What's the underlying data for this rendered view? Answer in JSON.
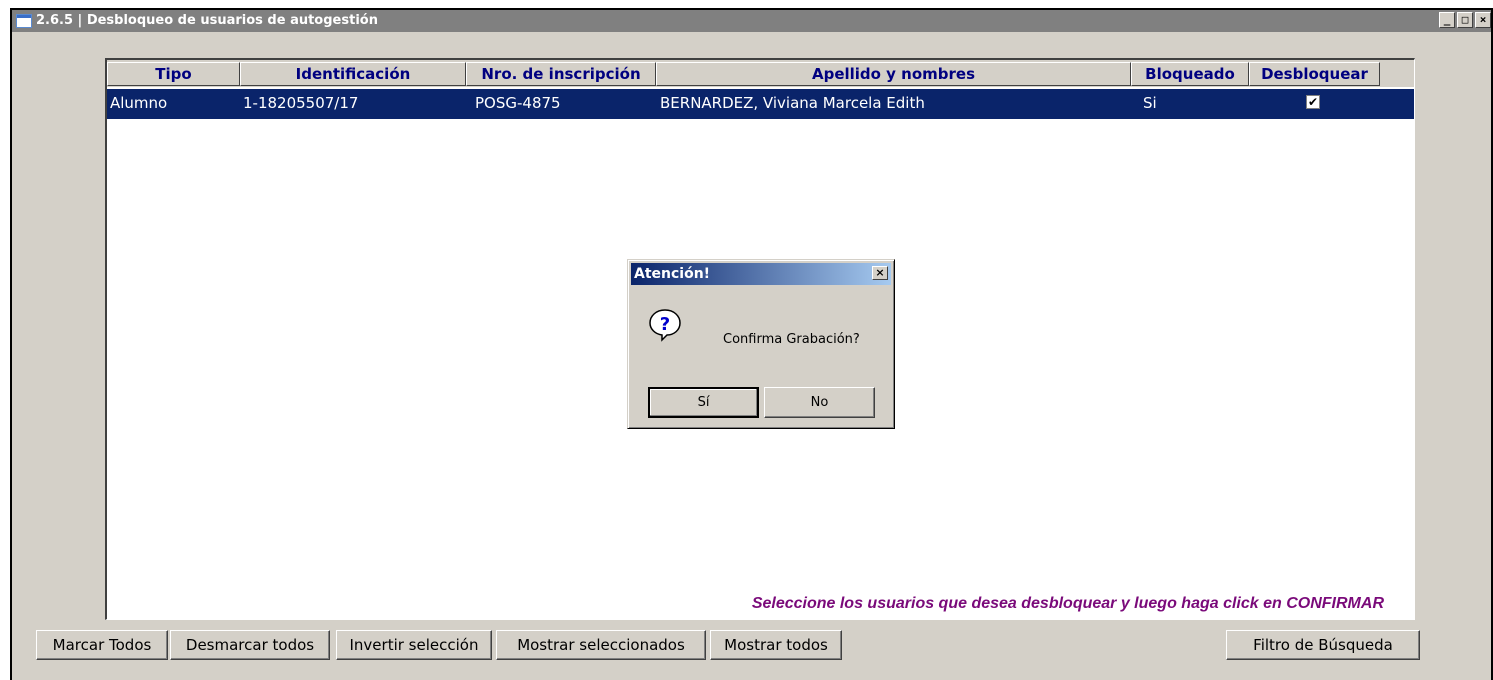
{
  "window": {
    "title": "2.6.5 | Desbloqueo de usuarios de autogestión",
    "controls": {
      "minimize": "_",
      "maximize": "□",
      "close": "×"
    }
  },
  "grid": {
    "columns": [
      "Tipo",
      "Identificación",
      "Nro. de inscripción",
      "Apellido y nombres",
      "Bloqueado",
      "Desbloquear"
    ],
    "rows": [
      {
        "tipo": "Alumno",
        "identificacion": "1-18205507/17",
        "nro_inscripcion": "POSG-4875",
        "apellido_nombres": "BERNARDEZ, Viviana Marcela Edith",
        "bloqueado": "Si",
        "desbloquear": "✔"
      }
    ],
    "hint": "Seleccione los usuarios que desea desbloquear y luego haga click en CONFIRMAR"
  },
  "buttons": {
    "marcar_todos": "Marcar Todos",
    "desmarcar_todos": "Desmarcar todos",
    "invertir": "Invertir selección",
    "mostrar_seleccionados": "Mostrar seleccionados",
    "mostrar_todos": "Mostrar todos",
    "filtro": "Filtro de Búsqueda"
  },
  "dialog": {
    "title": "Atención!",
    "message": "Confirma Grabación?",
    "yes": "Sí",
    "no": "No",
    "close": "×",
    "icon": "question-icon"
  },
  "colors": {
    "selection": "#0a246a",
    "header_text": "#000080",
    "hint_text": "#7a0a7a",
    "face": "#d4d0c8"
  }
}
